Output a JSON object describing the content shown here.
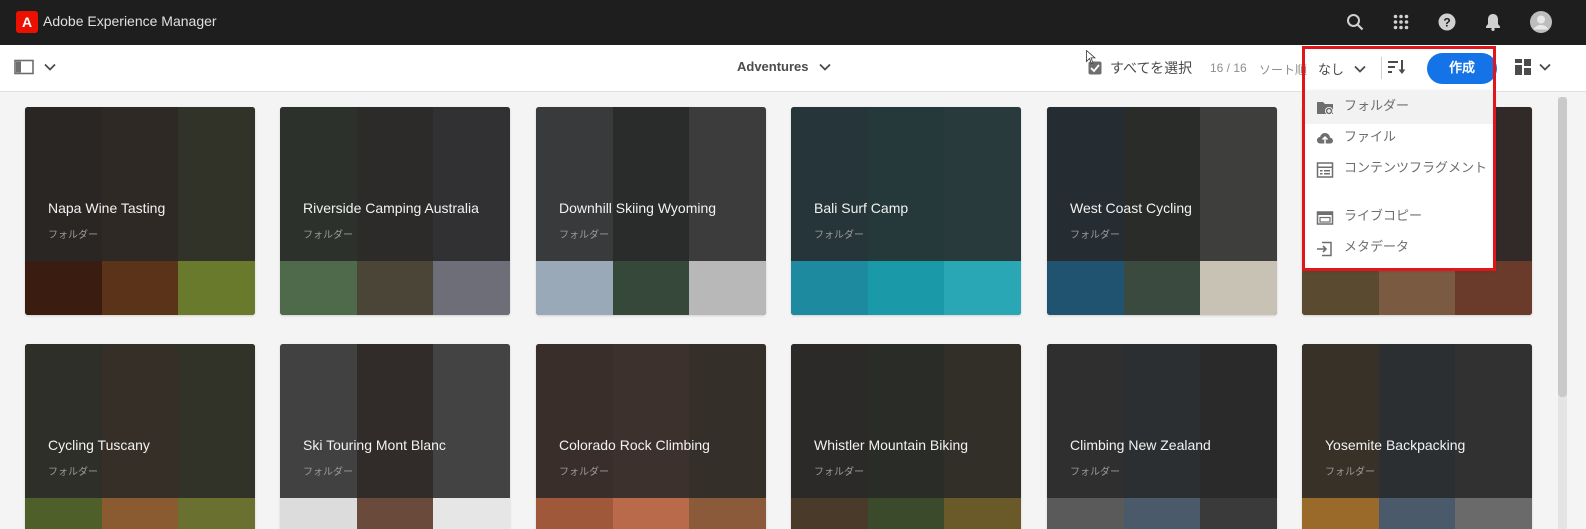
{
  "shell": {
    "logo": "A",
    "title": "Adobe Experience Manager",
    "icons": [
      "search-icon",
      "apps-grid-icon",
      "help-icon",
      "bell-icon",
      "user-avatar-icon"
    ]
  },
  "actionbar": {
    "breadcrumb": "Adventures",
    "select_all": "すべてを選択",
    "count": "16 / 16",
    "sort_label": "ソート順",
    "sort_value": "なし",
    "create": "作成"
  },
  "colors": {
    "accent": "#1473e6",
    "shell": "#1e1e1e",
    "highlight": "#e0161c"
  },
  "cards": [
    {
      "title": "Napa Wine Tasting",
      "type": "フォルダー",
      "swatches": [
        "#3a1d10",
        "#5a3318",
        "#6a7a2c"
      ]
    },
    {
      "title": "Riverside Camping Australia",
      "type": "フォルダー",
      "swatches": [
        "#4f6a4a",
        "#4a4536",
        "#6e6e78"
      ]
    },
    {
      "title": "Downhill Skiing Wyoming",
      "type": "フォルダー",
      "swatches": [
        "#9aa9b8",
        "#36483a",
        "#b8b8b8"
      ]
    },
    {
      "title": "Bali Surf Camp",
      "type": "フォルダー",
      "swatches": [
        "#1d8aa0",
        "#1a9aa8",
        "#2aa7b5"
      ]
    },
    {
      "title": "West Coast Cycling",
      "type": "フォルダー",
      "swatches": [
        "#1f5370",
        "#3b4a3e",
        "#c8c2b4"
      ]
    },
    {
      "title": "",
      "type": "",
      "swatches": [
        "#5a4a30",
        "#7a5a40",
        "#6a3a2a"
      ]
    },
    {
      "title": "Cycling Tuscany",
      "type": "フォルダー",
      "swatches": [
        "#4e5f2a",
        "#8a5a30",
        "#6a7030"
      ]
    },
    {
      "title": "Ski Touring Mont Blanc",
      "type": "フォルダー",
      "swatches": [
        "#dcdcdc",
        "#6a4a3a",
        "#e6e6e6"
      ]
    },
    {
      "title": "Colorado Rock Climbing",
      "type": "フォルダー",
      "swatches": [
        "#a0583a",
        "#b86a4a",
        "#8a5a3a"
      ]
    },
    {
      "title": "Whistler Mountain Biking",
      "type": "フォルダー",
      "swatches": [
        "#4a3a2a",
        "#3a4a2a",
        "#6a5a2a"
      ]
    },
    {
      "title": "Climbing New Zealand",
      "type": "フォルダー",
      "swatches": [
        "#5a5a5a",
        "#4a5a6a",
        "#3a3a3a"
      ]
    },
    {
      "title": "Yosemite Backpacking",
      "type": "フォルダー",
      "swatches": [
        "#9a6a2a",
        "#4a5a6a",
        "#6a6a6a"
      ]
    }
  ],
  "menu": {
    "items": [
      {
        "label": "フォルダー",
        "icon": "folder-add-icon"
      },
      {
        "label": "ファイル",
        "icon": "cloud-upload-icon"
      },
      {
        "label": "コンテンツフラグメント",
        "icon": "content-fragment-icon"
      },
      {
        "label": "ライブコピー",
        "icon": "live-copy-icon"
      },
      {
        "label": "メタデータ",
        "icon": "metadata-import-icon"
      }
    ]
  }
}
